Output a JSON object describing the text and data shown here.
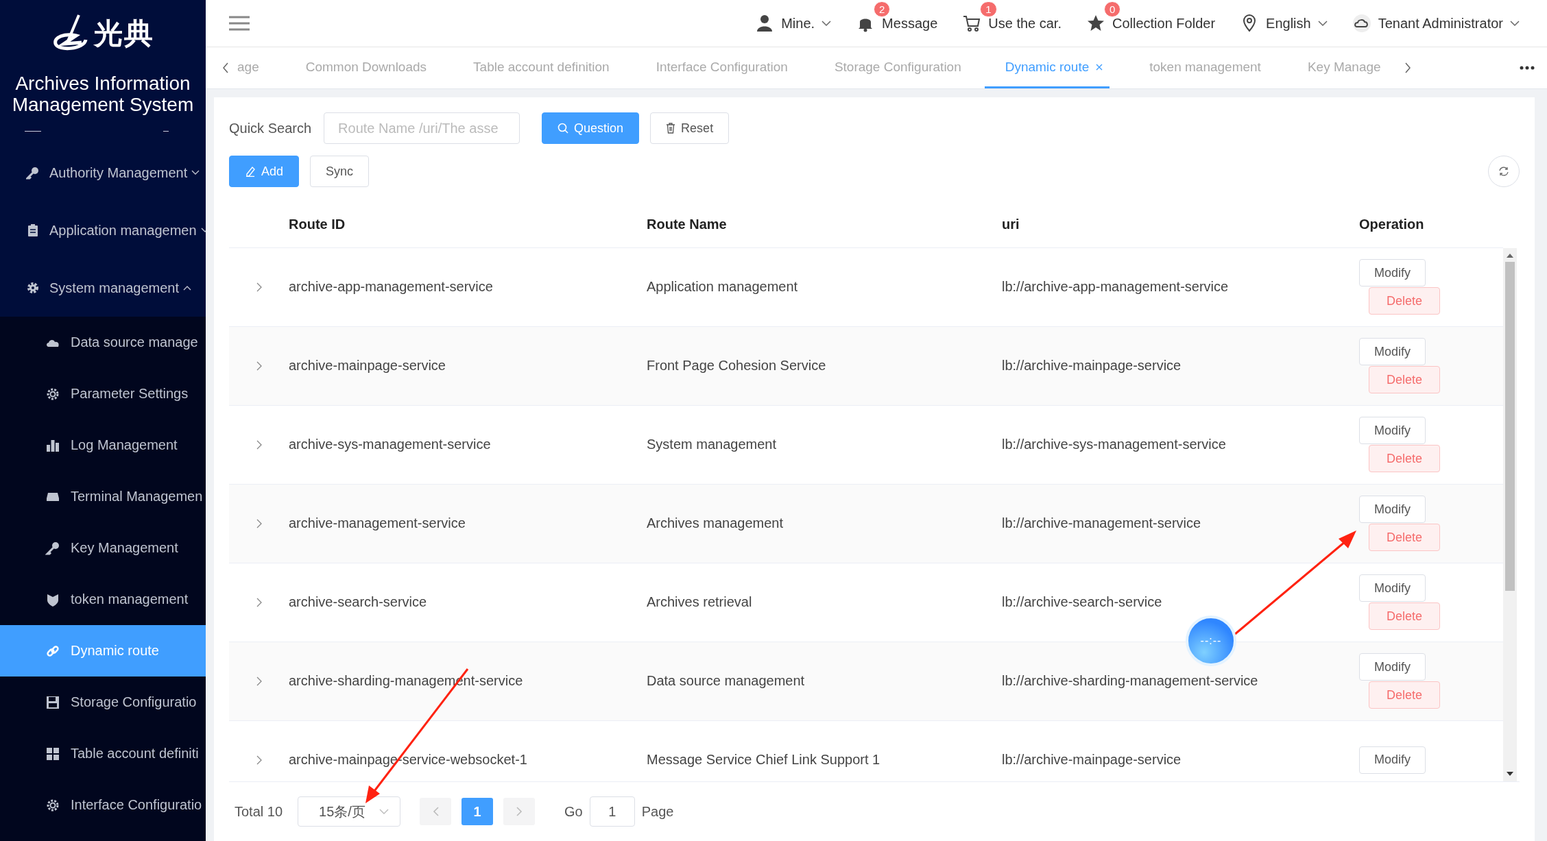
{
  "sidebar": {
    "logo_text": "光典",
    "title": "Archives Information Management System",
    "items": [
      {
        "label": "Authority Management",
        "selected": false,
        "expanded": false
      },
      {
        "label": "Application managemen",
        "selected": false,
        "expanded": false
      },
      {
        "label": "System management",
        "selected": false,
        "expanded": true,
        "children": [
          {
            "label": "Data source manage",
            "selected": false
          },
          {
            "label": "Parameter Settings",
            "selected": false
          },
          {
            "label": "Log Management",
            "selected": false
          },
          {
            "label": "Terminal Managemen",
            "selected": false
          },
          {
            "label": "Key Management",
            "selected": false
          },
          {
            "label": "token management",
            "selected": false
          },
          {
            "label": "Dynamic route",
            "selected": true
          },
          {
            "label": "Storage Configuratio",
            "selected": false
          },
          {
            "label": "Table account definiti",
            "selected": false
          },
          {
            "label": "Interface Configuratio",
            "selected": false
          }
        ]
      }
    ]
  },
  "header": {
    "items": [
      {
        "label": "Mine.",
        "kind": "dropdown"
      },
      {
        "label": "Message",
        "kind": "badge",
        "badge": "2"
      },
      {
        "label": "Use the car.",
        "kind": "badge",
        "badge": "1"
      },
      {
        "label": "Collection Folder",
        "kind": "badge",
        "badge": "0"
      },
      {
        "label": "English",
        "kind": "dropdown"
      },
      {
        "label": "Tenant Administrator",
        "kind": "dropdown"
      }
    ]
  },
  "tabs": [
    {
      "label": "age",
      "selected": false
    },
    {
      "label": "Common Downloads",
      "selected": false
    },
    {
      "label": "Table account definition",
      "selected": false
    },
    {
      "label": "Interface Configuration",
      "selected": false
    },
    {
      "label": "Storage Configuration",
      "selected": false
    },
    {
      "label": "Dynamic route",
      "selected": true
    },
    {
      "label": "token management",
      "selected": false
    },
    {
      "label": "Key Manage",
      "selected": false
    }
  ],
  "search": {
    "label": "Quick Search",
    "placeholder": "Route Name /uri/The asse",
    "search_button": "Question",
    "reset_button": "Reset"
  },
  "toolbar": {
    "add_button": "Add",
    "sync_button": "Sync"
  },
  "table": {
    "columns": [
      "Route ID",
      "Route Name",
      "uri",
      "Operation"
    ],
    "rows": [
      {
        "route_id": "archive-app-management-service",
        "route_name": "Application management",
        "uri": "lb://archive-app-management-service",
        "actions": [
          "Modify",
          "Delete"
        ]
      },
      {
        "route_id": "archive-mainpage-service",
        "route_name": "Front Page Cohesion Service",
        "uri": "lb://archive-mainpage-service",
        "actions": [
          "Modify",
          "Delete"
        ]
      },
      {
        "route_id": "archive-sys-management-service",
        "route_name": "System management",
        "uri": "lb://archive-sys-management-service",
        "actions": [
          "Modify",
          "Delete"
        ]
      },
      {
        "route_id": "archive-management-service",
        "route_name": "Archives management",
        "uri": "lb://archive-management-service",
        "actions": [
          "Modify",
          "Delete"
        ]
      },
      {
        "route_id": "archive-search-service",
        "route_name": "Archives retrieval",
        "uri": "lb://archive-search-service",
        "actions": [
          "Modify",
          "Delete"
        ]
      },
      {
        "route_id": "archive-sharding-management-service",
        "route_name": "Data source management",
        "uri": "lb://archive-sharding-management-service",
        "actions": [
          "Modify",
          "Delete"
        ]
      },
      {
        "route_id": "archive-mainpage-service-websocket-1",
        "route_name": "Message Service Chief Link Support 1",
        "uri": "lb://archive-mainpage-service",
        "actions": [
          "Modify"
        ]
      }
    ]
  },
  "pagination": {
    "total": "Total 10",
    "page_size": "15条/页",
    "pages": [
      {
        "label": "1",
        "selected": true
      }
    ],
    "goto_label": "Go",
    "goto_value": "1",
    "page_label": "Page"
  },
  "timer": {
    "text": "--:--"
  }
}
